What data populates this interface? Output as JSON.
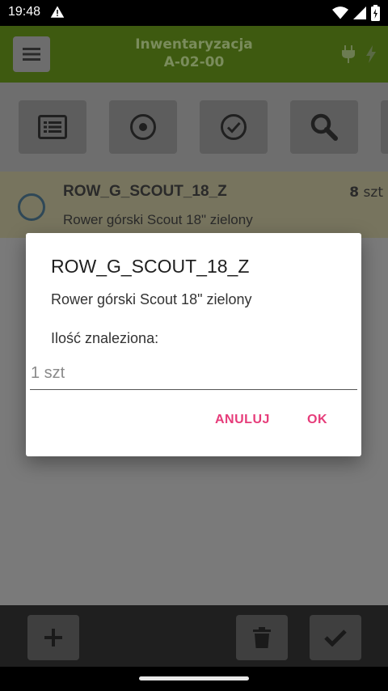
{
  "status_bar": {
    "time": "19:48"
  },
  "app_bar": {
    "title": "Inwentaryzacja",
    "subtitle": "A-02-00"
  },
  "toolbar": {
    "items": [
      {
        "icon": "list-icon"
      },
      {
        "icon": "radio-target-icon"
      },
      {
        "icon": "check-circle-icon"
      },
      {
        "icon": "search-icon"
      }
    ]
  },
  "list": {
    "items": [
      {
        "code": "ROW_G_SCOUT_18_Z",
        "qty": "8",
        "unit": "szt",
        "description": "Rower górski Scout 18\" zielony"
      }
    ]
  },
  "dialog": {
    "title": "ROW_G_SCOUT_18_Z",
    "description": "Rower górski Scout 18\" zielony",
    "label": "Ilość znaleziona:",
    "input_value": "",
    "input_placeholder": "1 szt",
    "cancel_label": "ANULUJ",
    "ok_label": "OK"
  },
  "colors": {
    "app_bar": "#8bc220",
    "accent": "#e63c7a",
    "list_item_bg": "#f5f0c4"
  }
}
